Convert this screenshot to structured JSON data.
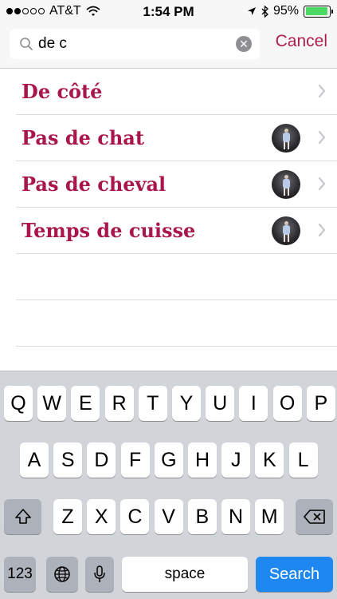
{
  "status_bar": {
    "carrier": "AT&T",
    "time": "1:54 PM",
    "battery": "95%",
    "battery_level": 0.95,
    "signal_filled": 2,
    "signal_total": 5,
    "battery_color": "#4cd964"
  },
  "search": {
    "query": "de c",
    "cancel_label": "Cancel",
    "accent_color": "#b01e4f"
  },
  "results": [
    {
      "label": "De côté",
      "has_thumbnail": false
    },
    {
      "label": "Pas de chat",
      "has_thumbnail": true
    },
    {
      "label": "Pas de cheval",
      "has_thumbnail": true
    },
    {
      "label": "Temps de cuisse",
      "has_thumbnail": true
    }
  ],
  "keyboard": {
    "row1": [
      "Q",
      "W",
      "E",
      "R",
      "T",
      "Y",
      "U",
      "I",
      "O",
      "P"
    ],
    "row2": [
      "A",
      "S",
      "D",
      "F",
      "G",
      "H",
      "J",
      "K",
      "L"
    ],
    "row3": [
      "Z",
      "X",
      "C",
      "V",
      "B",
      "N",
      "M"
    ],
    "numbers_label": "123",
    "space_label": "space",
    "search_label": "Search"
  }
}
